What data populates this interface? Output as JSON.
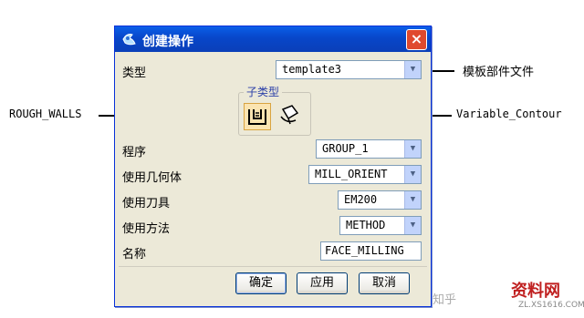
{
  "dialog": {
    "title": "创建操作",
    "close_icon": "×"
  },
  "fields": {
    "type": {
      "label": "类型",
      "value": "template3"
    },
    "subtype_label": "子类型",
    "program": {
      "label": "程序",
      "value": "GROUP_1"
    },
    "geometry": {
      "label": "使用几何体",
      "value": "MILL_ORIENT"
    },
    "tool": {
      "label": "使用刀具",
      "value": "EM200"
    },
    "method": {
      "label": "使用方法",
      "value": "METHOD"
    },
    "name": {
      "label": "名称",
      "value": "FACE_MILLING"
    }
  },
  "buttons": {
    "ok": "确定",
    "apply": "应用",
    "cancel": "取消"
  },
  "callouts": {
    "template_file": "模板部件文件",
    "rough_walls": "ROUGH_WALLS",
    "variable_contour": "Variable_Contour"
  },
  "watermark": {
    "zhihu": "知乎",
    "brand": "资料网",
    "url": "ZL.XS1616.COM"
  },
  "colors": {
    "titlebar": "#0846c9",
    "close": "#e04a2e",
    "dialog_bg": "#ece9d8"
  }
}
